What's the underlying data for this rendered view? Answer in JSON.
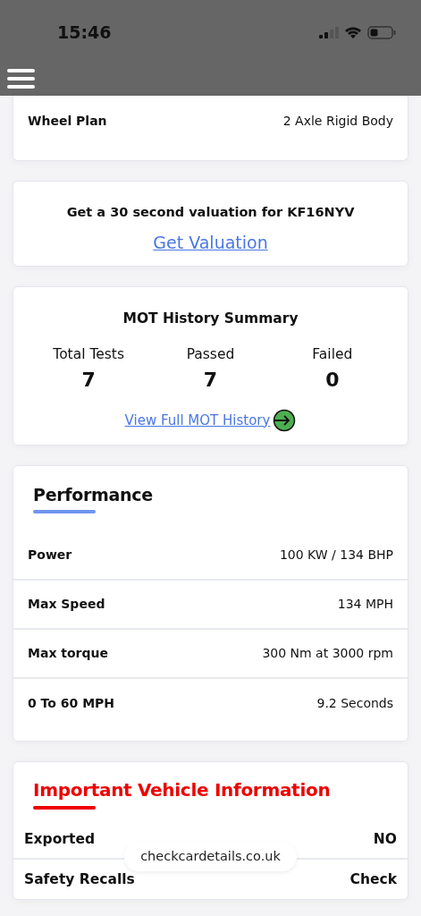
{
  "status_bar": {
    "time": "15:46"
  },
  "details": {
    "rows": [
      {
        "label": "Wheel Plan",
        "value": "2 Axle Rigid Body"
      }
    ]
  },
  "valuation": {
    "text": "Get a 30 second valuation for KF16NYV",
    "link": "Get Valuation"
  },
  "mot_summary": {
    "title": "MOT History Summary",
    "stats": [
      {
        "label": "Total Tests",
        "value": "7"
      },
      {
        "label": "Passed",
        "value": "7"
      },
      {
        "label": "Failed",
        "value": "0"
      }
    ],
    "link": "View Full MOT History"
  },
  "sections": [
    {
      "title": "Performance",
      "kind": "normal",
      "rows": [
        {
          "label": "Power",
          "value": "100 KW / 134 BHP"
        },
        {
          "label": "Max Speed",
          "value": "134 MPH"
        },
        {
          "label": "Max torque",
          "value": "300 Nm at 3000 rpm"
        },
        {
          "label": "0 To 60 MPH",
          "value": "9.2 Seconds"
        }
      ]
    },
    {
      "title": "Important Vehicle Information",
      "kind": "alert",
      "rows": [
        {
          "label": "Exported",
          "value": "NO"
        },
        {
          "label": "Safety Recalls",
          "value": "Check"
        }
      ]
    }
  ],
  "url_pill": "checkcardetails.co.uk"
}
